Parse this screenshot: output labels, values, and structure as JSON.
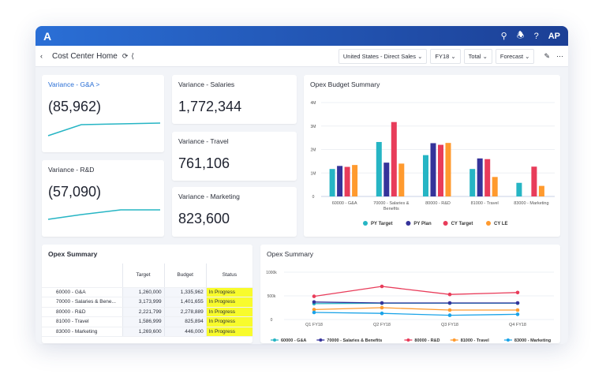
{
  "header": {
    "logo": "A",
    "user": "AP",
    "icons": [
      "search-icon",
      "bell-icon",
      "help-icon"
    ]
  },
  "toolbar": {
    "title": "Cost Center Home",
    "filters": [
      "United States - Direct Sales",
      "FY18",
      "Total",
      "Forecast"
    ]
  },
  "kpis": {
    "ga": {
      "label": "Variance - G&A >",
      "value": "(85,962)"
    },
    "rd": {
      "label": "Variance - R&D",
      "value": "(57,090)"
    },
    "salaries": {
      "label": "Variance - Salaries",
      "value": "1,772,344"
    },
    "travel": {
      "label": "Variance - Travel",
      "value": "761,106"
    },
    "marketing": {
      "label": "Variance - Marketing",
      "value": "823,600"
    }
  },
  "colors": {
    "accent": "#2a6fd6",
    "cyan": "#26b5c4",
    "navy": "#35339a",
    "red": "#e83c5a",
    "orange": "#ff9a2e",
    "blue": "#1aa3e8",
    "highlight": "#f8fb2c"
  },
  "table": {
    "title": "Opex Summary",
    "headers": [
      "",
      "Target",
      "Budget",
      "Status"
    ],
    "rows": [
      [
        "60000 - G&A",
        "1,260,000",
        "1,335,962",
        "In Progress"
      ],
      [
        "70000 - Salaries & Bene...",
        "3,173,999",
        "1,401,655",
        "In Progress"
      ],
      [
        "80000 - R&D",
        "2,221,799",
        "2,278,889",
        "In Progress"
      ],
      [
        "81000 - Travel",
        "1,586,999",
        "825,894",
        "In Progress"
      ],
      [
        "83000 - Marketing",
        "1,269,600",
        "446,000",
        "In Progress"
      ]
    ]
  },
  "chart_data": [
    {
      "type": "bar",
      "title": "Opex Budget Summary",
      "categories": [
        "60000 - G&A",
        "70000 - Salaries & Benefits",
        "80000 - R&D",
        "81000 - Travel",
        "83000 - Marketing"
      ],
      "ylim": [
        0,
        4
      ],
      "yticks": [
        "0",
        "1M",
        "2M",
        "3M",
        "4M"
      ],
      "legend": "bottom",
      "series": [
        {
          "name": "PY Target",
          "values": [
            1.17,
            2.32,
            1.76,
            1.17,
            0.58
          ]
        },
        {
          "name": "PY Plan",
          "values": [
            1.3,
            1.44,
            2.27,
            1.62,
            0
          ]
        },
        {
          "name": "CY Target",
          "values": [
            1.26,
            3.17,
            2.2,
            1.59,
            1.27
          ]
        },
        {
          "name": "CY LE",
          "values": [
            1.34,
            1.4,
            2.28,
            0.83,
            0.45
          ]
        }
      ]
    },
    {
      "type": "line",
      "title": "Opex Summary",
      "categories": [
        "Q1 FY18",
        "Q2 FY18",
        "Q3 FY18",
        "Q4 FY18"
      ],
      "ylim": [
        0,
        1000
      ],
      "yticks": [
        "0",
        "500k",
        "1000k"
      ],
      "legend": "bottom",
      "series": [
        {
          "name": "60000 - G&A",
          "values": [
            335,
            345,
            345,
            345
          ]
        },
        {
          "name": "70000 - Salaries & Benefits",
          "values": [
            370,
            350,
            350,
            350
          ]
        },
        {
          "name": "80000 - R&D",
          "values": [
            490,
            700,
            530,
            570
          ]
        },
        {
          "name": "81000 - Travel",
          "values": [
            210,
            250,
            200,
            200
          ]
        },
        {
          "name": "83000 - Marketing",
          "values": [
            150,
            130,
            90,
            110
          ]
        }
      ]
    }
  ]
}
